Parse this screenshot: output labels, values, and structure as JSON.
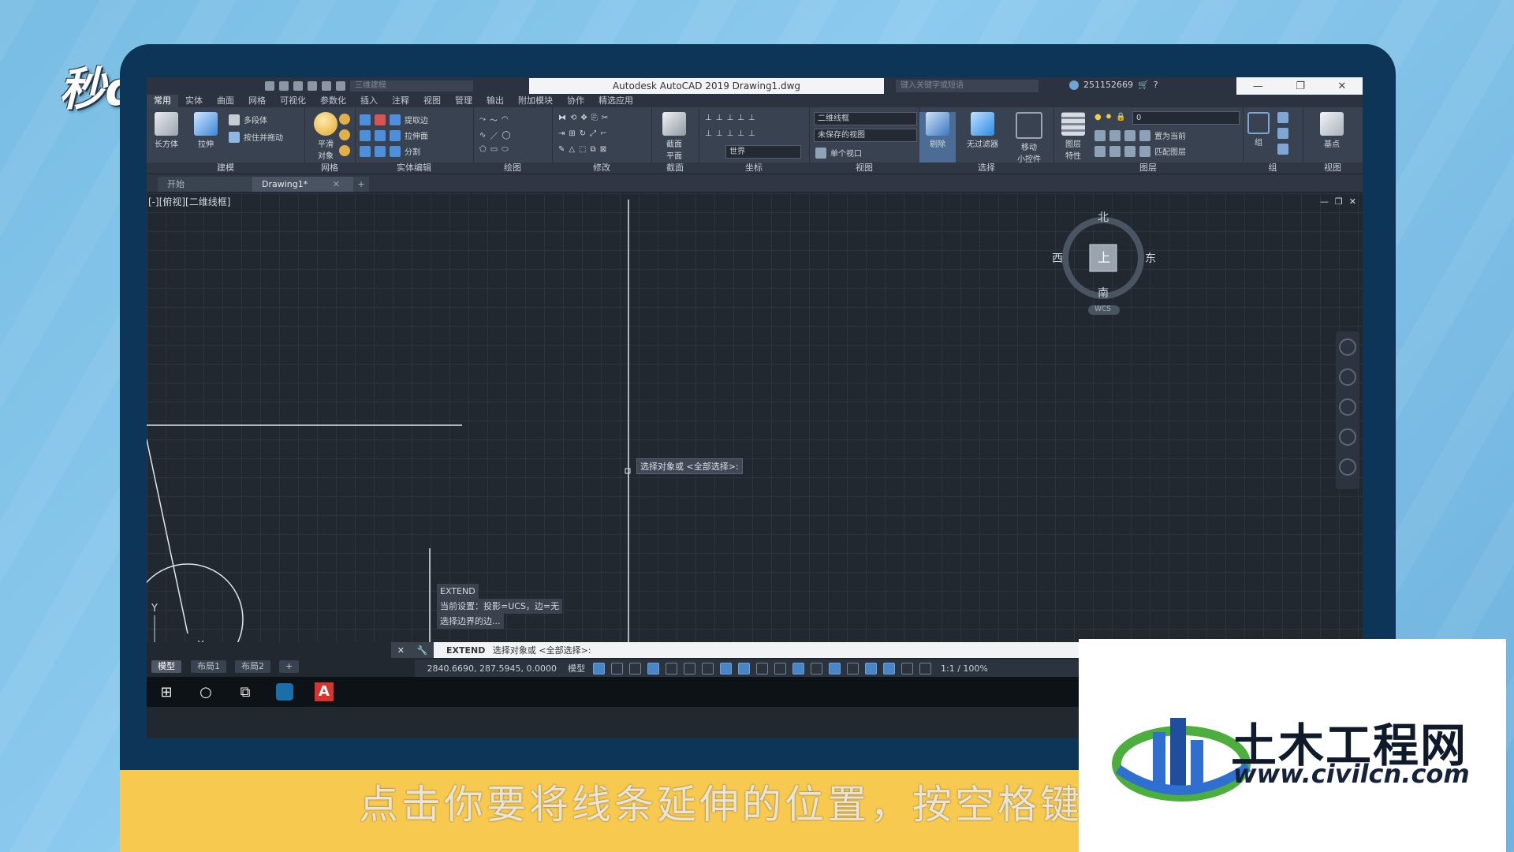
{
  "watermark_topleft": "秒dong视频",
  "app": {
    "window_title": "Autodesk AutoCAD 2019    Drawing1.dwg",
    "workspace": "三维建模",
    "search_placeholder": "键入关键字或短语",
    "user_id": "251152669",
    "window_controls": [
      "—",
      "❐",
      "✕"
    ]
  },
  "ribbon_tabs": [
    "常用",
    "实体",
    "曲面",
    "网格",
    "可视化",
    "参数化",
    "插入",
    "注释",
    "视图",
    "管理",
    "输出",
    "附加模块",
    "协作",
    "精选应用"
  ],
  "ribbon": {
    "modeling": {
      "label": "建模",
      "box": "长方体",
      "extrude": "拉伸",
      "polysolid": "多段体",
      "presspull": "按住并拖动"
    },
    "mesh": {
      "label": "网格",
      "smooth": "平滑\n对象"
    },
    "solid_edit": {
      "label": "实体编辑",
      "extract_edges": "提取边",
      "extrude_faces": "拉伸面",
      "separate": "分割"
    },
    "draw": {
      "label": "绘图"
    },
    "modify": {
      "label": "修改"
    },
    "section": {
      "label": "截面",
      "plane": "截面\n平面"
    },
    "coords": {
      "label": "坐标",
      "world": "世界"
    },
    "view": {
      "label": "视图",
      "visual_style": "二维线框",
      "saved_view": "未保存的视图",
      "viewport": "单个视口"
    },
    "selection": {
      "label": "选择",
      "cull": "剔除",
      "no_filter": "无过滤器",
      "gizmo": "移动\n小控件"
    },
    "layers": {
      "label": "图层",
      "layer_props": "图层\n特性",
      "layer_value": "0",
      "set_current": "置为当前",
      "match_layer": "匹配图层"
    },
    "groups": {
      "label": "组",
      "group": "组"
    },
    "view2": {
      "label": "视图",
      "base": "基点"
    }
  },
  "doc_tabs": {
    "start": "开始",
    "drawing": "Drawing1*",
    "close": "✕",
    "new": "+"
  },
  "viewport": {
    "label": "[-][俯视][二维线框]",
    "controls": [
      "—",
      "❐",
      "✕"
    ],
    "tooltip": "选择对象或 <全部选择>:",
    "navcube": {
      "top": "上",
      "north": "北",
      "south": "南",
      "east": "东",
      "west": "西",
      "ucs": "WCS"
    },
    "ucs_y": "Y",
    "ucs_x": "X"
  },
  "command_history": [
    "EXTEND",
    "当前设置：投影=UCS，边=无",
    "选择边界的边..."
  ],
  "command_line": {
    "prompt_cmd": "EXTEND",
    "prompt_text": "选择对象或 <全部选择>:"
  },
  "layout_tabs": [
    "模型",
    "布局1",
    "布局2",
    "+"
  ],
  "status_bar": {
    "coords": "2840.6690, 287.5945, 0.0000",
    "model": "模型",
    "scale": "1:1 / 100%"
  },
  "caption": "点击你要将线条延伸的位置，按空格键",
  "watermark": {
    "cn": "土木工程网",
    "url": "www.civilcn.com"
  },
  "colors": {
    "accent_blue": "#2f6fd0",
    "logo_green": "#4cae3c",
    "caption_yellow": "#f8c94f"
  }
}
